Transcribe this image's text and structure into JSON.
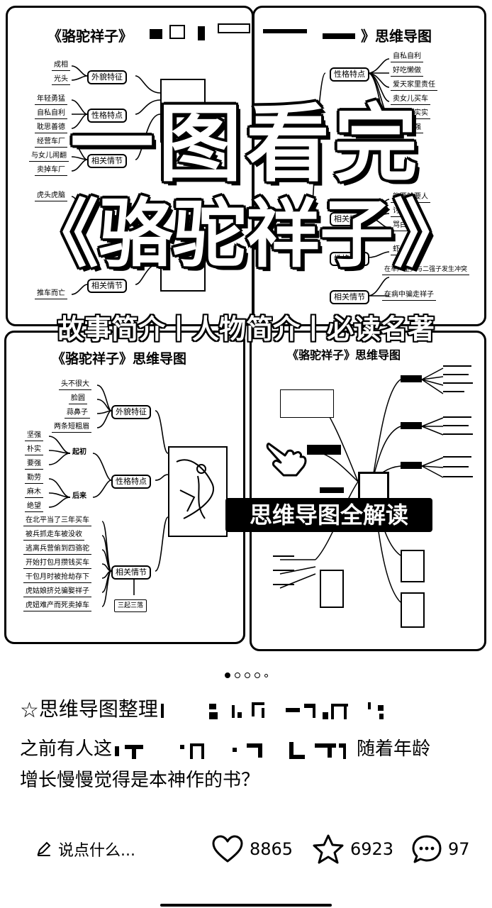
{
  "hero": {
    "panel1_title": "《骆驼祥子》",
    "panel2_title": "》思维导图",
    "panel3_title": "《骆驼祥子》思维导图",
    "panel4_title": "《骆驼祥子》思维导图",
    "headline_line1": "一图看完",
    "headline_line2": "《骆驼祥子》",
    "subtitle": "故事简介丨人物简介丨必读名著",
    "banner": "思维导图全解读",
    "p1_nodes": [
      "外貌特征",
      "性格特点",
      "相关情节",
      "相关情节"
    ],
    "p1_leaves": [
      "成相",
      "光头",
      "年轻勇猛",
      "自私自利",
      "耽思善德",
      "经营车厂",
      "与女儿闹翻",
      "卖掉车厂",
      "虎头虎脑",
      "推车而亡"
    ],
    "p2_nodes": [
      "性格特点",
      "相关情节",
      "性格特点",
      "相关情节"
    ],
    "p2_leaves": [
      "自私自利",
      "好吃懒做",
      "爱天家里责任",
      "卖女儿买车",
      "不老老实实",
      "女儿自强",
      "能要钱要人",
      "讨钱",
      "骂白条",
      "虾你",
      "在车厂里头与二强子发生冲突",
      "在病中骗走祥子"
    ],
    "p3_nodes": [
      "外貌特征",
      "性格特点",
      "相关情节"
    ],
    "p3_mid": [
      "起初",
      "后来"
    ],
    "p3_leaves_top": [
      "头不很大",
      "脸圆",
      "蒜鼻子",
      "两条短粗眉"
    ],
    "p3_leaves_left": [
      "坚强",
      "朴实",
      "要强",
      "勤劳",
      "麻木",
      "绝望"
    ],
    "p3_leaves_bottom": [
      "在北平当了三年买车",
      "被兵抓走车被没收",
      "逃离兵营偷到四骆驼",
      "开始打包月攒钱买车",
      "干包月时被抢劫存下",
      "虎姑娘挤兑骗娶祥子",
      "虎妞难产而死卖掉车"
    ],
    "p3_small_box": "三起三落"
  },
  "carousel": {
    "count": 5,
    "active": 0
  },
  "post": {
    "title_prefix": "思维导图整理",
    "body_prefix": "之前有人这",
    "body_mid": "随着年龄",
    "body_line2": "增长慢慢觉得是本神作的书？"
  },
  "actions": {
    "comment_placeholder": "说点什么...",
    "likes": "8865",
    "favorites": "6923",
    "comments": "97"
  },
  "icons": {
    "comment_edit": "pencil-icon",
    "like": "heart-icon",
    "favorite": "star-icon",
    "comment": "chat-bubble-icon",
    "title_star": "star-outline-icon"
  }
}
